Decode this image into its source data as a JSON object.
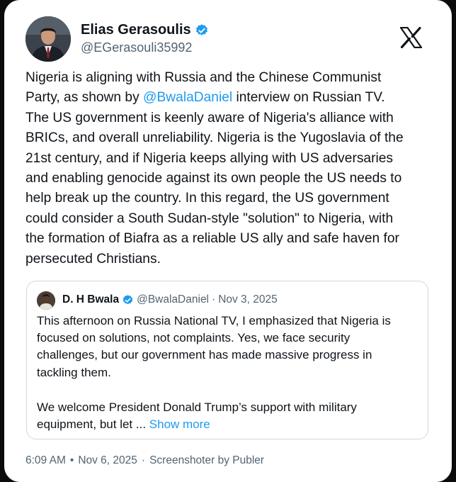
{
  "author": {
    "name": "Elias Gerasoulis",
    "handle": "@EGerasouli35992",
    "verified_icon": "verified-badge-icon",
    "brand_icon": "x-logo-icon"
  },
  "post": {
    "lines": [
      {
        "a": "Nigeria is aligning with Russia and the Chinese Communist",
        "m": "",
        "b": ""
      },
      {
        "a": "Party, as shown by ",
        "m": "@BwalaDaniel",
        "b": " interview on Russian TV."
      },
      {
        "a": "The US government is keenly aware of Nigeria's alliance with",
        "m": "",
        "b": ""
      },
      {
        "a": "BRICs, and overall unreliability. Nigeria is the Yugoslavia of the",
        "m": "",
        "b": ""
      },
      {
        "a": "21st century, and if Nigeria keeps allying with US adversaries",
        "m": "",
        "b": ""
      },
      {
        "a": "and enabling genocide against its own people the US needs to",
        "m": "",
        "b": ""
      },
      {
        "a": "help break up the country. In this regard, the US government",
        "m": "",
        "b": ""
      },
      {
        "a": "could consider a South Sudan-style \"solution\" to Nigeria, with",
        "m": "",
        "b": ""
      },
      {
        "a": "the formation of Biafra as a reliable US ally and safe haven for",
        "m": "",
        "b": ""
      },
      {
        "a": "persecuted Christians.",
        "m": "",
        "b": ""
      }
    ]
  },
  "quote": {
    "name": "D. H Bwala",
    "handle": "@BwalaDaniel",
    "separator": "·",
    "date": "Nov 3, 2025",
    "lines": [
      "This afternoon on Russia National TV, I emphasized that Nigeria is",
      "focused on solutions, not complaints. Yes, we face security",
      "challenges, but our government has made massive progress in",
      "tackling them."
    ],
    "lines2": [
      "We welcome President Donald Trump’s support with military"
    ],
    "last_line": "equipment, but let ...",
    "show_more": "Show more"
  },
  "meta": {
    "time": "6:09 AM",
    "dot": "•",
    "date": "Nov 6, 2025",
    "sep": "·",
    "source": "Screenshoter by Publer"
  },
  "colors": {
    "accent": "#1d9bf0",
    "text": "#0f1419",
    "muted": "#536471",
    "border": "#cfd9de"
  }
}
